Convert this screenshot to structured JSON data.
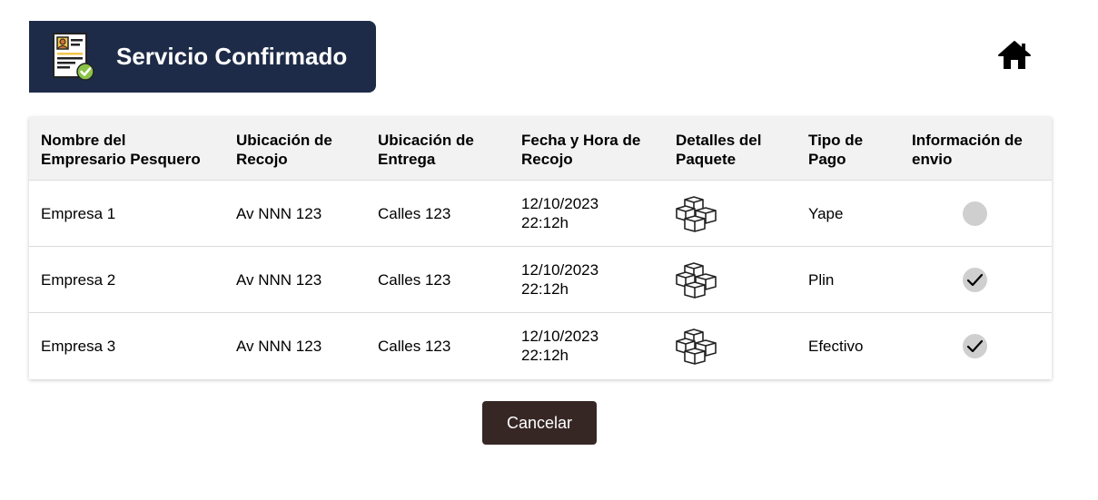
{
  "header": {
    "title": "Servicio Confirmado",
    "icon": "confirmed-document-icon",
    "background": "#1e2b48"
  },
  "nav": {
    "home_icon": "home-icon"
  },
  "table": {
    "headers": [
      [
        "Nombre del",
        "Empresario Pesquero"
      ],
      [
        "Ubicación de",
        "Recojo"
      ],
      [
        "Ubicación de",
        "Entrega"
      ],
      [
        "Fecha y Hora de",
        "Recojo"
      ],
      [
        "Detalles del",
        "Paquete"
      ],
      [
        "Tipo de",
        "Pago"
      ],
      [
        "Información de",
        "envio"
      ]
    ],
    "rows": [
      {
        "empresa": "Empresa 1",
        "recojo": "Av NNN 123",
        "entrega": "Calles 123",
        "fecha": "12/10/2023",
        "hora": "22:12h",
        "paquete_icon": "packages-icon",
        "pago": "Yape",
        "envio_status": "pending"
      },
      {
        "empresa": "Empresa 2",
        "recojo": "Av NNN 123",
        "entrega": "Calles 123",
        "fecha": "12/10/2023",
        "hora": "22:12h",
        "paquete_icon": "packages-icon",
        "pago": "Plin",
        "envio_status": "confirmed"
      },
      {
        "empresa": "Empresa 3",
        "recojo": "Av NNN 123",
        "entrega": "Calles 123",
        "fecha": "12/10/2023",
        "hora": "22:12h",
        "paquete_icon": "packages-icon",
        "pago": "Efectivo",
        "envio_status": "confirmed"
      }
    ]
  },
  "actions": {
    "cancel_label": "Cancelar",
    "cancel_color": "#362725"
  }
}
